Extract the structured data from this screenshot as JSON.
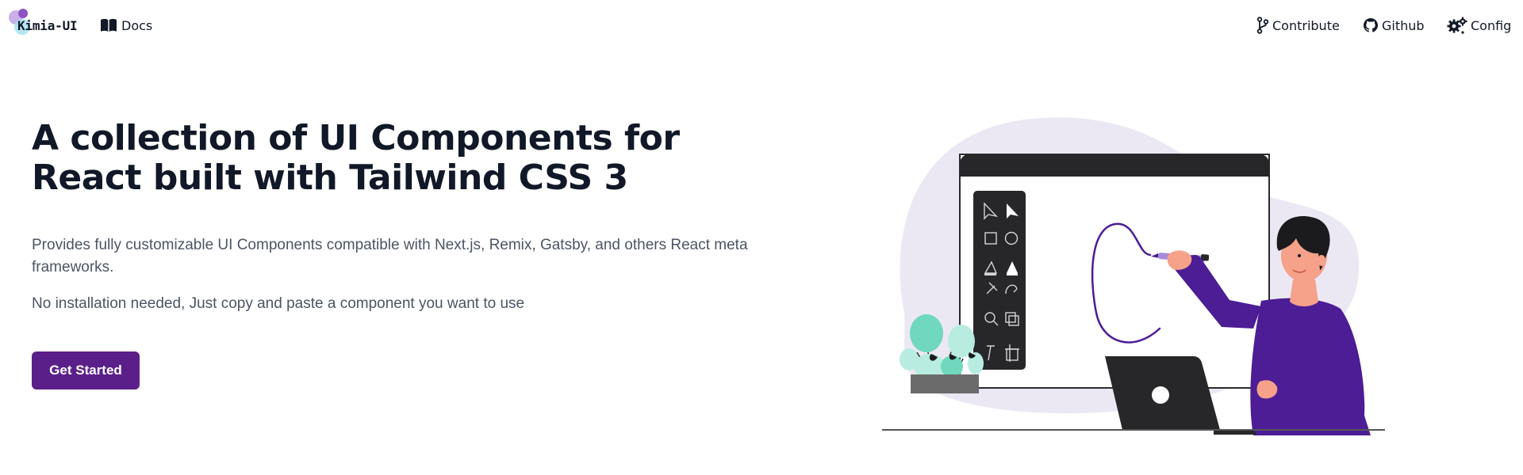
{
  "nav": {
    "brand": "Kimia-UI",
    "docs": "Docs",
    "contribute": "Contribute",
    "github": "Github",
    "config": "Config"
  },
  "hero": {
    "title_line1": "A collection of UI Components for",
    "title_line2": "React built with Tailwind CSS 3",
    "description": "Provides fully customizable UI Components compatible with Next.js, Remix, Gatsby, and others React meta frameworks.",
    "note": "No installation needed, Just copy and paste a component you want to use",
    "cta_label": "Get Started"
  },
  "icons": {
    "docs": "book-icon",
    "contribute": "git-branch-icon",
    "github": "github-icon",
    "config": "gears-icon"
  },
  "colors": {
    "accent": "#5b1f8a",
    "text": "#111827",
    "muted": "#4b5563",
    "blob": "#ebe8f4",
    "shirt": "#4c1d95",
    "plant": "#6fd8bd"
  }
}
